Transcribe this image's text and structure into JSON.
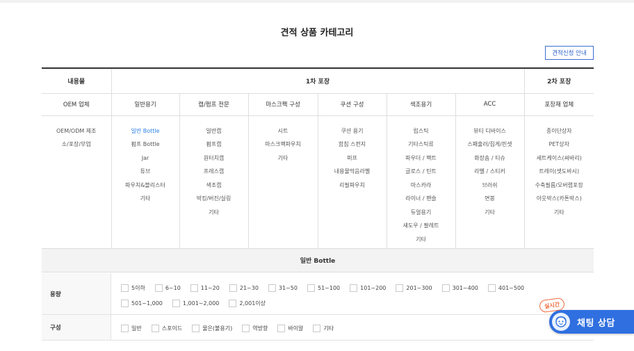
{
  "page_title": "견적 상품 카테고리",
  "quote_button": "견적신청 안내",
  "table": {
    "header1": [
      "내용물",
      "1차 포장",
      "2차 포장"
    ],
    "header2": [
      "OEM 업체",
      "일반용기",
      "캡/펌프 전문",
      "마스크팩 구성",
      "쿠션 구성",
      "색조용기",
      "ACC",
      "포장재 업체"
    ],
    "columns": [
      [
        "OEM/ODM 제조",
        "소/포장/부업"
      ],
      [
        "일반 Bottle",
        "펌프 Bottle",
        "Jar",
        "튜브",
        "파우치&블리스터",
        "기타"
      ],
      [
        "일반캡",
        "펌프캡",
        "원터치캡",
        "프레스캡",
        "색조캡",
        "박킹/버진/실링",
        "기타"
      ],
      [
        "시트",
        "마스크팩파우치",
        "기타"
      ],
      [
        "쿠션 용기",
        "함침 스펀지",
        "퍼프",
        "내용물막음라벨",
        "리필파우치"
      ],
      [
        "립스틱",
        "기타스틱류",
        "파우더 / 팩트",
        "글로스 / 틴트",
        "마스카라",
        "라이너 / 펜슬",
        "듀얼용기",
        "섀도우 / 팔레트",
        "기타"
      ],
      [
        "뷰티 디바이스",
        "스패출러/집게/핀셋",
        "화장솜 / 티슈",
        "라벨 / 스티커",
        "브러쉬",
        "면봉",
        "기타"
      ],
      [
        "종이단상자",
        "PET상자",
        "세트케이스(싸바리)",
        "트레이(셋도바시)",
        "수축필름/오버랩포장",
        "아웃박스(카톤박스)",
        "기타"
      ]
    ],
    "active_item": "일반 Bottle"
  },
  "selected_category": "일반 Bottle",
  "capacity": {
    "label": "용량",
    "options": [
      "5이하",
      "6~10",
      "11~20",
      "21~30",
      "31~50",
      "51~100",
      "101~200",
      "201~300",
      "301~400",
      "401~500",
      "501~1,000",
      "1,001~2,000",
      "2,001이상"
    ]
  },
  "composition": {
    "label": "구성",
    "options": [
      "일반",
      "스포이드",
      "물은(불용기)",
      "역방향",
      "바이알",
      "기타"
    ]
  },
  "chat": {
    "badge": "실시간",
    "label": "채팅 상담"
  }
}
